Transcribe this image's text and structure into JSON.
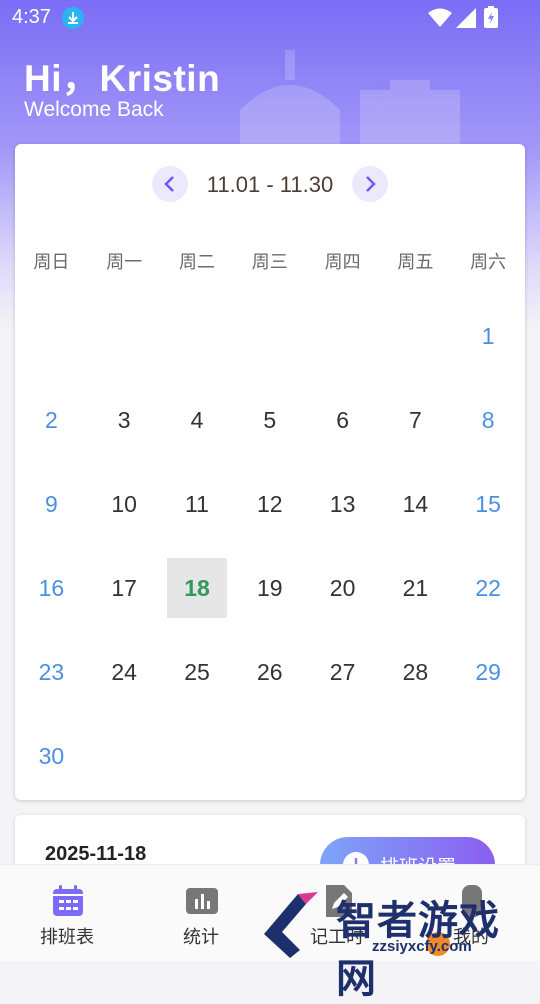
{
  "status": {
    "time": "4:37"
  },
  "header": {
    "greeting": "Hi，Kristin",
    "subtitle": "Welcome Back"
  },
  "calendar": {
    "range": "11.01 - 11.30",
    "weekdays": [
      "周日",
      "周一",
      "周二",
      "周三",
      "周四",
      "周五",
      "周六"
    ],
    "weeks": [
      [
        "",
        "",
        "",
        "",
        "",
        "",
        "1"
      ],
      [
        "2",
        "3",
        "4",
        "5",
        "6",
        "7",
        "8"
      ],
      [
        "9",
        "10",
        "11",
        "12",
        "13",
        "14",
        "15"
      ],
      [
        "16",
        "17",
        "18",
        "19",
        "20",
        "21",
        "22"
      ],
      [
        "23",
        "24",
        "25",
        "26",
        "27",
        "28",
        "29"
      ],
      [
        "30",
        "",
        "",
        "",
        "",
        "",
        ""
      ]
    ],
    "selected": "18"
  },
  "detail": {
    "date": "2025-11-18",
    "settings_label": "排班设置"
  },
  "tabs": [
    {
      "label": "排班表",
      "icon": "calendar-icon"
    },
    {
      "label": "统计",
      "icon": "bar-chart-icon"
    },
    {
      "label": "记工时",
      "icon": "edit-icon"
    },
    {
      "label": "我的",
      "icon": "user-icon"
    }
  ],
  "watermark": {
    "text": "智者游戏网",
    "url": "zzsiyxcfy.com"
  },
  "colors": {
    "accent": "#7b6df6",
    "weekend": "#4a90e2",
    "selected_text": "#2e9a5c"
  }
}
